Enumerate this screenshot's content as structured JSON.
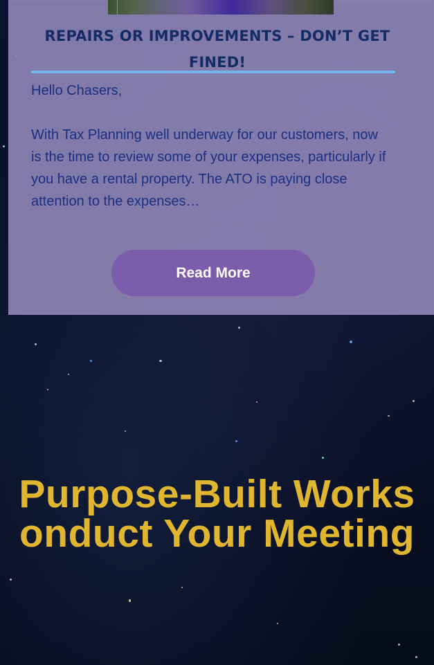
{
  "post": {
    "title": "REPAIRS OR IMPROVEMENTS – DON’T GET FINED!",
    "greeting": "Hello Chasers,",
    "excerpt": "With Tax Planning well underway for our customers, now is the time to review some of your expenses, particularly if you have a rental property. The ATO is paying close attention to the expenses…",
    "read_more_label": "Read More"
  },
  "promo": {
    "line1": "Purpose-Built Works",
    "line2": "onduct Your Meeting"
  },
  "colors": {
    "title": "#142b66",
    "accent_rule": "#73b6ee",
    "button": "#7c5dac",
    "promo_text": "#e0b52f"
  }
}
